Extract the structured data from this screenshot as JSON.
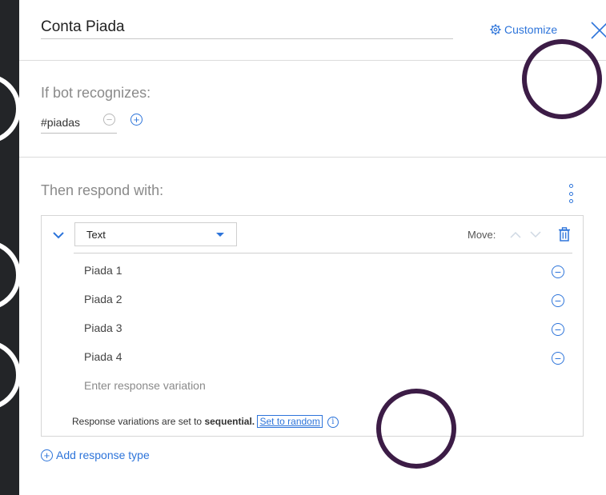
{
  "header": {
    "title": "Conta Piada",
    "customize_label": "Customize"
  },
  "condition": {
    "label": "If bot recognizes:",
    "intent": "#piadas"
  },
  "response": {
    "label": "Then respond with:",
    "type": "Text",
    "move_label": "Move:",
    "variations": [
      "Piada 1",
      "Piada 2",
      "Piada 3",
      "Piada 4"
    ],
    "new_variation_placeholder": "Enter response variation",
    "footer_prefix": "Response variations are set to",
    "footer_mode": "sequential.",
    "set_random_label": "Set to random"
  },
  "add_response_type_label": "Add response type",
  "colors": {
    "accent": "#2d74da",
    "annotation": "#3c1c46"
  },
  "icons": [
    "gear-icon",
    "close-icon",
    "minus-circle-icon",
    "plus-circle-icon",
    "kebab-icon",
    "chevron-down-icon",
    "dropdown-arrow-icon",
    "arrow-up-icon",
    "arrow-down-icon",
    "trash-icon",
    "info-icon"
  ]
}
